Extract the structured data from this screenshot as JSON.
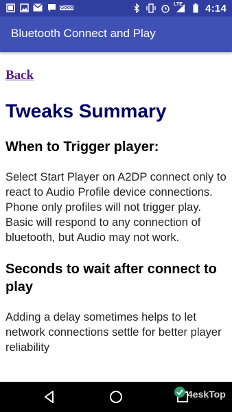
{
  "status_bar": {
    "time": "4:14",
    "network_tag": "LTE",
    "good_tag": "Good",
    "left_icons": [
      "notification-box-icon",
      "image-icon",
      "gmail-icon",
      "chat-icon",
      "good-app-icon"
    ],
    "right_icons": [
      "bluetooth-icon",
      "vibrate-icon",
      "alarm-icon",
      "signal-icon",
      "battery-icon"
    ]
  },
  "app_bar": {
    "title": "Bluetooth Connect and Play"
  },
  "content": {
    "back_label": "Back",
    "page_title": "Tweaks Summary",
    "sections": [
      {
        "heading": "When to Trigger player:",
        "body": "Select Start Player on A2DP connect only to react to Audio Profile device connections. Phone only profiles will not trigger play.  Basic will respond to any connection of bluetooth, but Audio may not work."
      },
      {
        "heading": "Seconds to wait after connect to play",
        "body": "Adding a delay sometimes helps to  let network connections settle for better player reliability"
      }
    ]
  },
  "nav_bar": {
    "buttons": [
      "back",
      "home",
      "recents"
    ]
  },
  "watermark": {
    "text": "4eskTop"
  },
  "colors": {
    "status_bar": "#303f9f",
    "app_bar": "#3f51b5",
    "title": "#000066",
    "link": "#551a8b"
  }
}
